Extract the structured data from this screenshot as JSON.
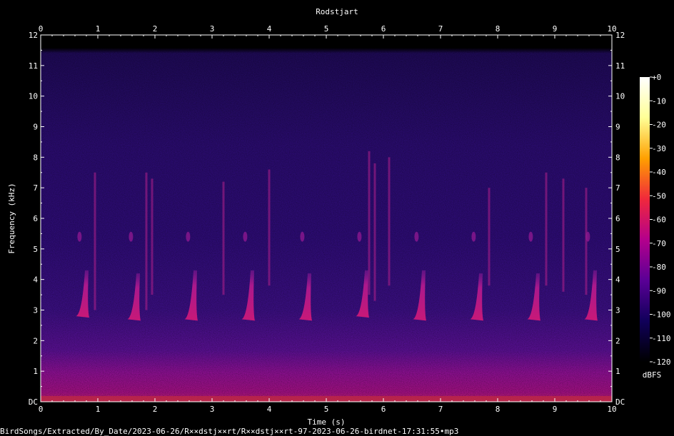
{
  "chart_data": {
    "type": "heatmap",
    "title": "Rodstjart",
    "xlabel": "Time (s)",
    "ylabel": "Frequency (kHz)",
    "xlim": [
      0,
      10
    ],
    "ylim": [
      0,
      12
    ],
    "x_ticks": [
      "0",
      "1",
      "2",
      "3",
      "4",
      "5",
      "6",
      "7",
      "8",
      "9",
      "10"
    ],
    "y_ticks": [
      "DC",
      "1",
      "2",
      "3",
      "4",
      "5",
      "6",
      "7",
      "8",
      "9",
      "10",
      "11",
      "12"
    ],
    "colorbar": {
      "label": "dBFS",
      "range": [
        -120,
        0
      ],
      "ticks": [
        "+0",
        "-10",
        "-20",
        "-30",
        "-40",
        "-50",
        "-60",
        "-70",
        "-80",
        "-90",
        "-100",
        "-110",
        "-120"
      ],
      "colors": [
        "#000000",
        "#10005a",
        "#5a0096",
        "#b4008c",
        "#f0283c",
        "#ffa000",
        "#ffff96",
        "#ffffff"
      ]
    },
    "notes": [
      {
        "t": 0.8,
        "f_low": 2.8,
        "f_high": 4.3
      },
      {
        "t": 1.7,
        "f_low": 2.7,
        "f_high": 4.2
      },
      {
        "t": 2.7,
        "f_low": 2.7,
        "f_high": 4.3
      },
      {
        "t": 3.7,
        "f_low": 2.7,
        "f_high": 4.3
      },
      {
        "t": 4.7,
        "f_low": 2.7,
        "f_high": 4.2
      },
      {
        "t": 5.7,
        "f_low": 2.8,
        "f_high": 4.3
      },
      {
        "t": 6.7,
        "f_low": 2.7,
        "f_high": 4.3
      },
      {
        "t": 7.7,
        "f_low": 2.7,
        "f_high": 4.2
      },
      {
        "t": 8.7,
        "f_low": 2.7,
        "f_high": 4.2
      },
      {
        "t": 9.7,
        "f_low": 2.7,
        "f_high": 4.3
      }
    ],
    "vertical_streaks": [
      {
        "t": 0.95,
        "f_low": 3.0,
        "f_high": 7.5
      },
      {
        "t": 1.85,
        "f_low": 3.0,
        "f_high": 7.5
      },
      {
        "t": 1.95,
        "f_low": 3.5,
        "f_high": 7.3
      },
      {
        "t": 3.2,
        "f_low": 3.5,
        "f_high": 7.2
      },
      {
        "t": 4.0,
        "f_low": 3.8,
        "f_high": 7.6
      },
      {
        "t": 5.75,
        "f_low": 3.5,
        "f_high": 8.2
      },
      {
        "t": 5.85,
        "f_low": 3.3,
        "f_high": 7.8
      },
      {
        "t": 6.1,
        "f_low": 3.8,
        "f_high": 8.0
      },
      {
        "t": 7.85,
        "f_low": 3.8,
        "f_high": 7.0
      },
      {
        "t": 8.85,
        "f_low": 3.8,
        "f_high": 7.5
      },
      {
        "t": 9.15,
        "f_low": 3.6,
        "f_high": 7.3
      },
      {
        "t": 9.55,
        "f_low": 3.5,
        "f_high": 7.0
      }
    ]
  },
  "footer": {
    "file_path": "BirdSongs/Extracted/By_Date/2023-06-26/R××dstj××rt/R××dstj××rt-97-2023-06-26-birdnet-17:31:55•mp3"
  }
}
